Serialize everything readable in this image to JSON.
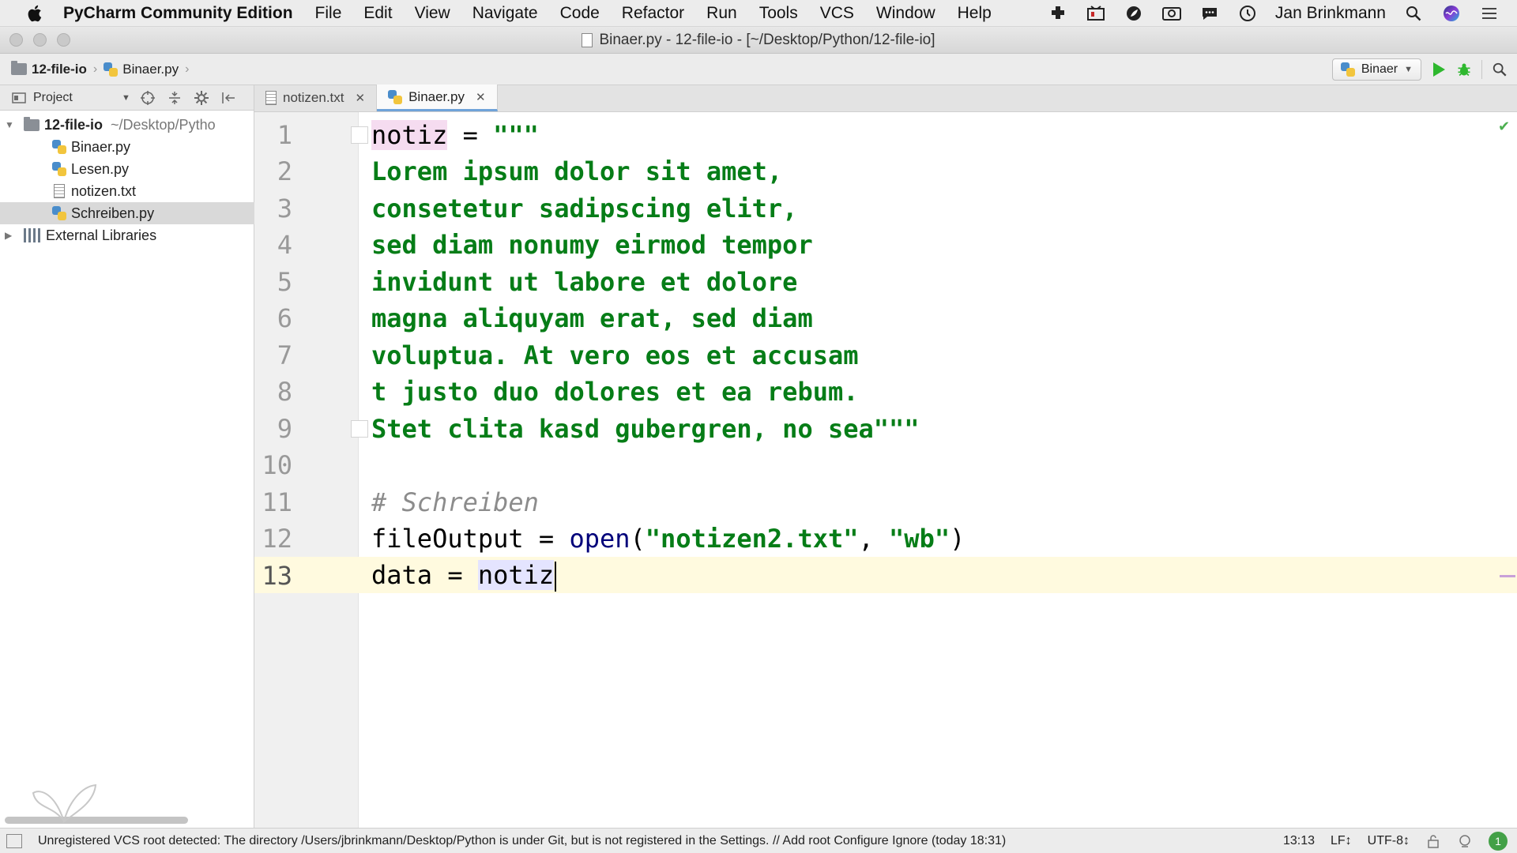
{
  "menubar": {
    "app_name": "PyCharm Community Edition",
    "items": [
      "File",
      "Edit",
      "View",
      "Navigate",
      "Code",
      "Refactor",
      "Run",
      "Tools",
      "VCS",
      "Window",
      "Help"
    ],
    "user": "Jan Brinkmann"
  },
  "window": {
    "title": "Binaer.py - 12-file-io - [~/Desktop/Python/12-file-io]"
  },
  "navbar": {
    "breadcrumb": [
      "12-file-io",
      "Binaer.py"
    ],
    "run_config": "Binaer"
  },
  "project_panel": {
    "header_label": "Project",
    "root_name": "12-file-io",
    "root_path": "~/Desktop/Pytho",
    "files": [
      {
        "name": "Binaer.py",
        "type": "python",
        "selected": false
      },
      {
        "name": "Lesen.py",
        "type": "python",
        "selected": false
      },
      {
        "name": "notizen.txt",
        "type": "text",
        "selected": false
      },
      {
        "name": "Schreiben.py",
        "type": "python",
        "selected": true
      }
    ],
    "external_libraries": "External Libraries"
  },
  "tabs": [
    {
      "label": "notizen.txt",
      "active": false
    },
    {
      "label": "Binaer.py",
      "active": true
    }
  ],
  "editor": {
    "line_numbers": [
      "1",
      "2",
      "3",
      "4",
      "5",
      "6",
      "7",
      "8",
      "9",
      "10",
      "11",
      "12",
      "13"
    ],
    "current_line": 13,
    "lines": {
      "l1_var": "notiz",
      "l1_rest": " = ",
      "l1_str": "\"\"\"",
      "l2": "Lorem ipsum dolor sit amet,",
      "l3": "consetetur sadipscing elitr,",
      "l4": "sed diam nonumy eirmod tempor",
      "l5": "invidunt ut labore et dolore",
      "l6": "magna aliquyam erat, sed diam",
      "l7": "voluptua. At vero eos et accusam",
      "l8": "t justo duo dolores et ea rebum.",
      "l9": "Stet clita kasd gubergren, no sea\"\"\"",
      "l11": "# Schreiben",
      "l12_a": "fileOutput = ",
      "l12_fn": "open",
      "l12_b": "(",
      "l12_s1": "\"notizen2.txt\"",
      "l12_c": ", ",
      "l12_s2": "\"wb\"",
      "l12_d": ")",
      "l13_a": "data = ",
      "l13_var": "notiz"
    }
  },
  "statusbar": {
    "message": "Unregistered VCS root detected: The directory /Users/jbrinkmann/Desktop/Python is under Git, but is not registered in the Settings. // Add root  Configure  Ignore (today 18:31)",
    "position": "13:13",
    "line_sep": "LF↕",
    "encoding": "UTF-8↕",
    "notifications": "1"
  },
  "icons": {
    "apple": "apple-icon",
    "run": "run-icon",
    "debug": "debug-icon",
    "search": "search-icon"
  },
  "colors": {
    "string": "#067d17",
    "comment": "#8c8c8c",
    "builtin": "#00007a",
    "current_line": "#fffadf",
    "run_green": "#2eb82e"
  }
}
